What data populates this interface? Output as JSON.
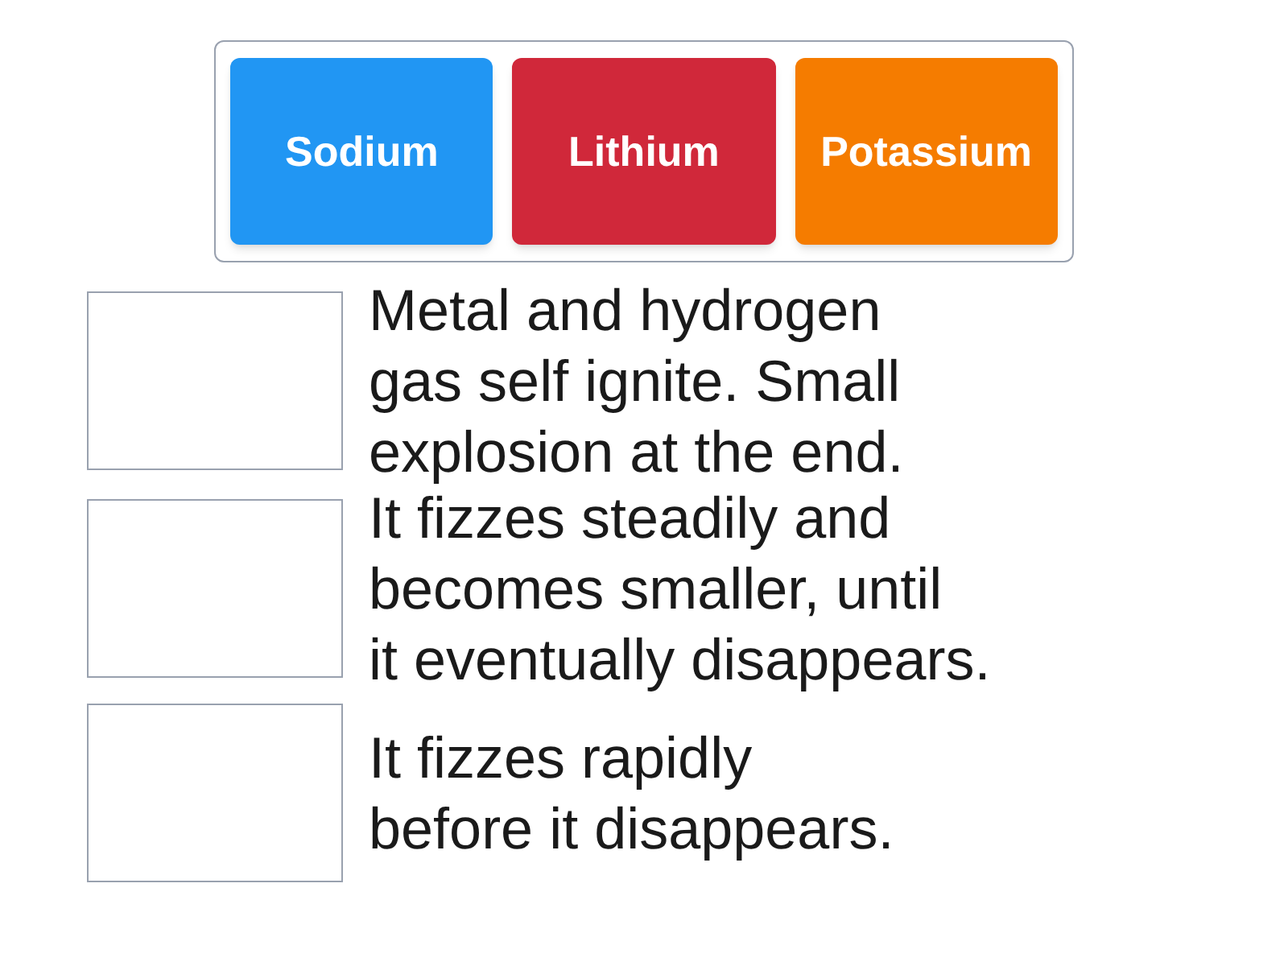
{
  "tiles": [
    {
      "label": "Sodium",
      "color": "#2196f3"
    },
    {
      "label": "Lithium",
      "color": "#d0283a"
    },
    {
      "label": "Potassium",
      "color": "#f57c00"
    }
  ],
  "rows": [
    {
      "answer_lines": [
        "Metal and hydrogen",
        "gas self ignite. Small",
        "explosion at the end."
      ]
    },
    {
      "answer_lines": [
        "It fizzes steadily and",
        "becomes smaller, until",
        "it eventually disappears."
      ]
    },
    {
      "answer_lines": [
        "It fizzes rapidly",
        "before it disappears."
      ]
    }
  ]
}
